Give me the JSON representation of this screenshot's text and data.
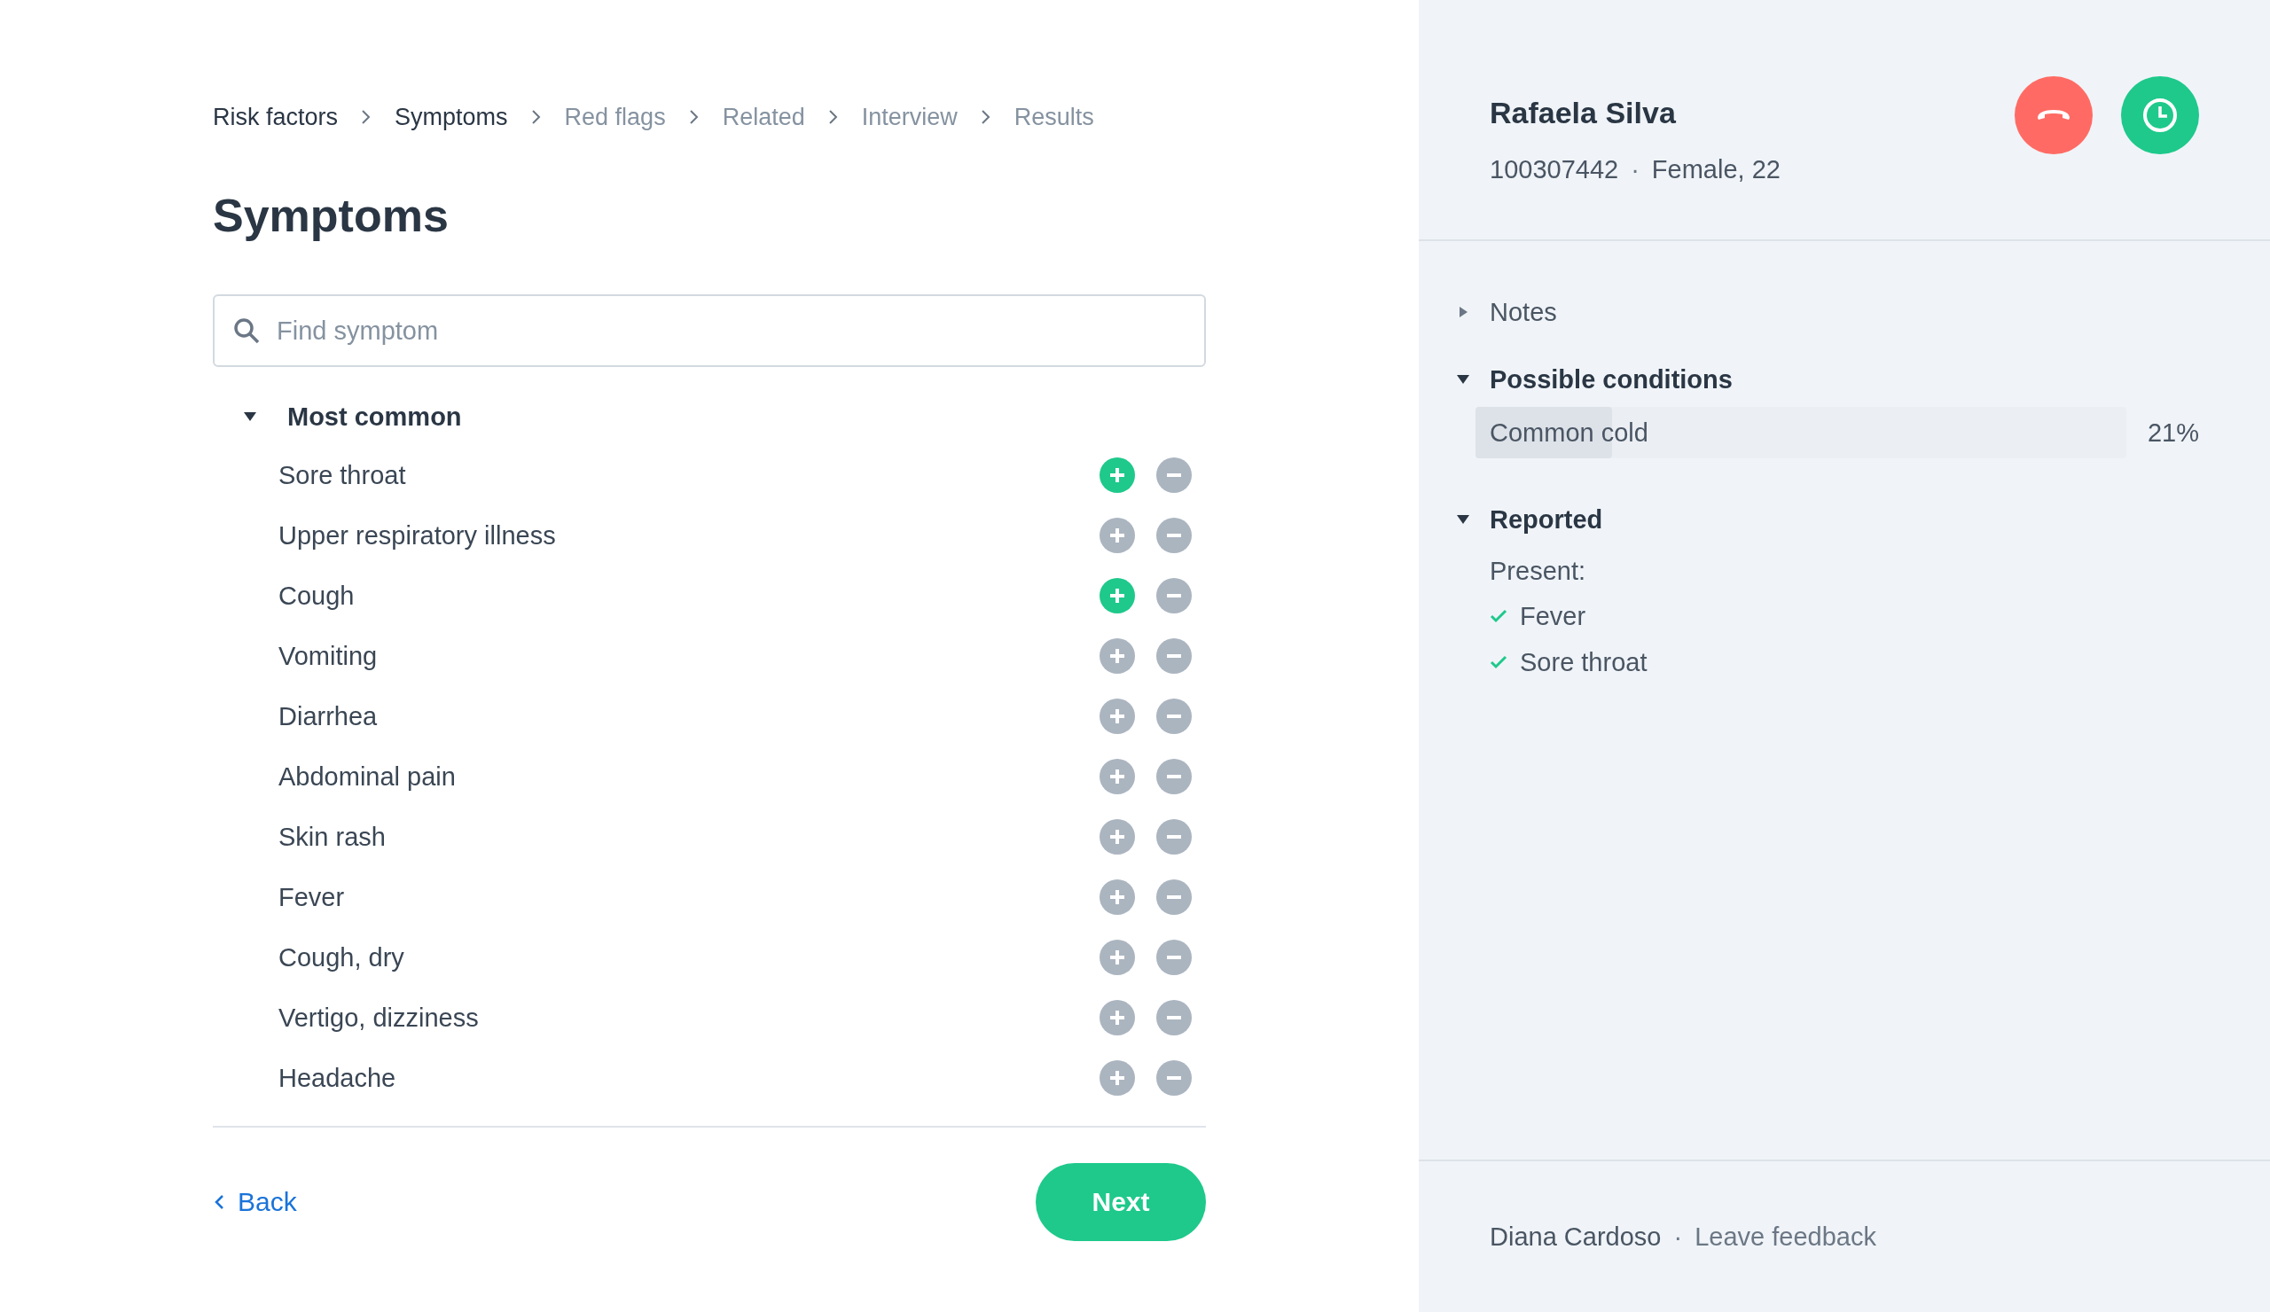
{
  "breadcrumb": [
    {
      "label": "Risk factors",
      "visited": true
    },
    {
      "label": "Symptoms",
      "visited": true
    },
    {
      "label": "Red flags",
      "visited": false
    },
    {
      "label": "Related",
      "visited": false
    },
    {
      "label": "Interview",
      "visited": false
    },
    {
      "label": "Results",
      "visited": false
    }
  ],
  "title": "Symptoms",
  "search": {
    "placeholder": "Find symptom"
  },
  "group": {
    "title": "Most common",
    "expanded": true,
    "items": [
      {
        "label": "Sore throat",
        "present": true
      },
      {
        "label": "Upper respiratory illness",
        "present": false
      },
      {
        "label": "Cough",
        "present": true
      },
      {
        "label": "Vomiting",
        "present": false
      },
      {
        "label": "Diarrhea",
        "present": false
      },
      {
        "label": "Abdominal pain",
        "present": false
      },
      {
        "label": "Skin rash",
        "present": false
      },
      {
        "label": "Fever",
        "present": false
      },
      {
        "label": "Cough, dry",
        "present": false
      },
      {
        "label": "Vertigo, dizziness",
        "present": false
      },
      {
        "label": "Headache",
        "present": false
      }
    ]
  },
  "back": "Back",
  "next": "Next",
  "patient": {
    "name": "Rafaela Silva",
    "id": "100307442",
    "separator": "·",
    "info": "Female, 22"
  },
  "notes": {
    "title": "Notes",
    "expanded": false
  },
  "conditions": {
    "title": "Possible conditions",
    "expanded": true,
    "items": [
      {
        "label": "Common cold",
        "level": 0.21,
        "reading": "21%"
      }
    ]
  },
  "reported": {
    "title": "Reported",
    "expanded": true,
    "subtitle": "Present:",
    "items": [
      "Fever",
      "Sore throat"
    ]
  },
  "footer": {
    "user": "Diana Cardoso",
    "separator": "·",
    "link": "Leave feedback"
  }
}
